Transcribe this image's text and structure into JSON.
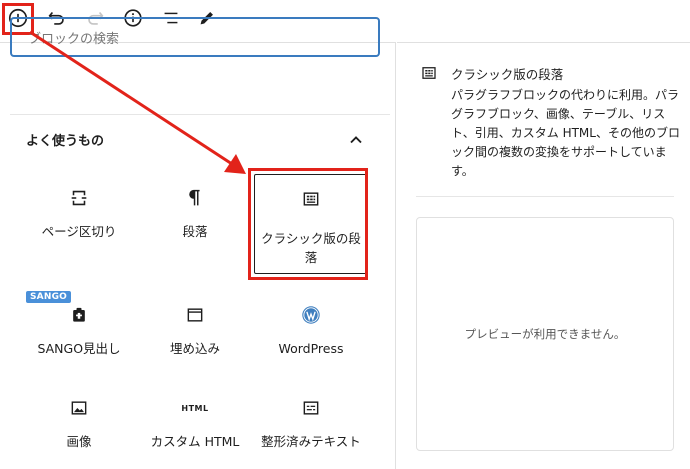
{
  "toolbar": {
    "icons": [
      "add-block-icon",
      "undo-icon",
      "redo-icon",
      "info-icon",
      "list-view-icon",
      "edit-icon"
    ]
  },
  "search": {
    "placeholder": "ブロックの検索"
  },
  "section": {
    "title": "よく使うもの"
  },
  "blocks": [
    {
      "label": "ページ区切り",
      "icon": "page-break-icon"
    },
    {
      "label": "段落",
      "icon": "pilcrow-icon"
    },
    {
      "label": "クラシック版の段落",
      "icon": "classic-icon",
      "selected": true
    },
    {
      "label": "SANGO見出し",
      "icon": "heading-icon",
      "badge": "SANGO"
    },
    {
      "label": "埋め込み",
      "icon": "embed-icon"
    },
    {
      "label": "WordPress",
      "icon": "wordpress-icon"
    },
    {
      "label": "画像",
      "icon": "image-icon"
    },
    {
      "label": "カスタム HTML",
      "icon": "html-icon",
      "icon_text": "HTML"
    },
    {
      "label": "整形済みテキスト",
      "icon": "preformatted-icon"
    }
  ],
  "detail": {
    "title": "クラシック版の段落",
    "description": "パラグラフブロックの代わりに利用。パラグラフブロック、画像、テーブル、リスト、引用、カスタム HTML、その他のブロック間の複数の変換をサポートしています。",
    "preview_text": "プレビューが利用できません。"
  },
  "colors": {
    "highlight": "#e2231a",
    "focus": "#3a7bbf",
    "badge": "#4a90d9",
    "wordpress": "#3f7fbf"
  }
}
